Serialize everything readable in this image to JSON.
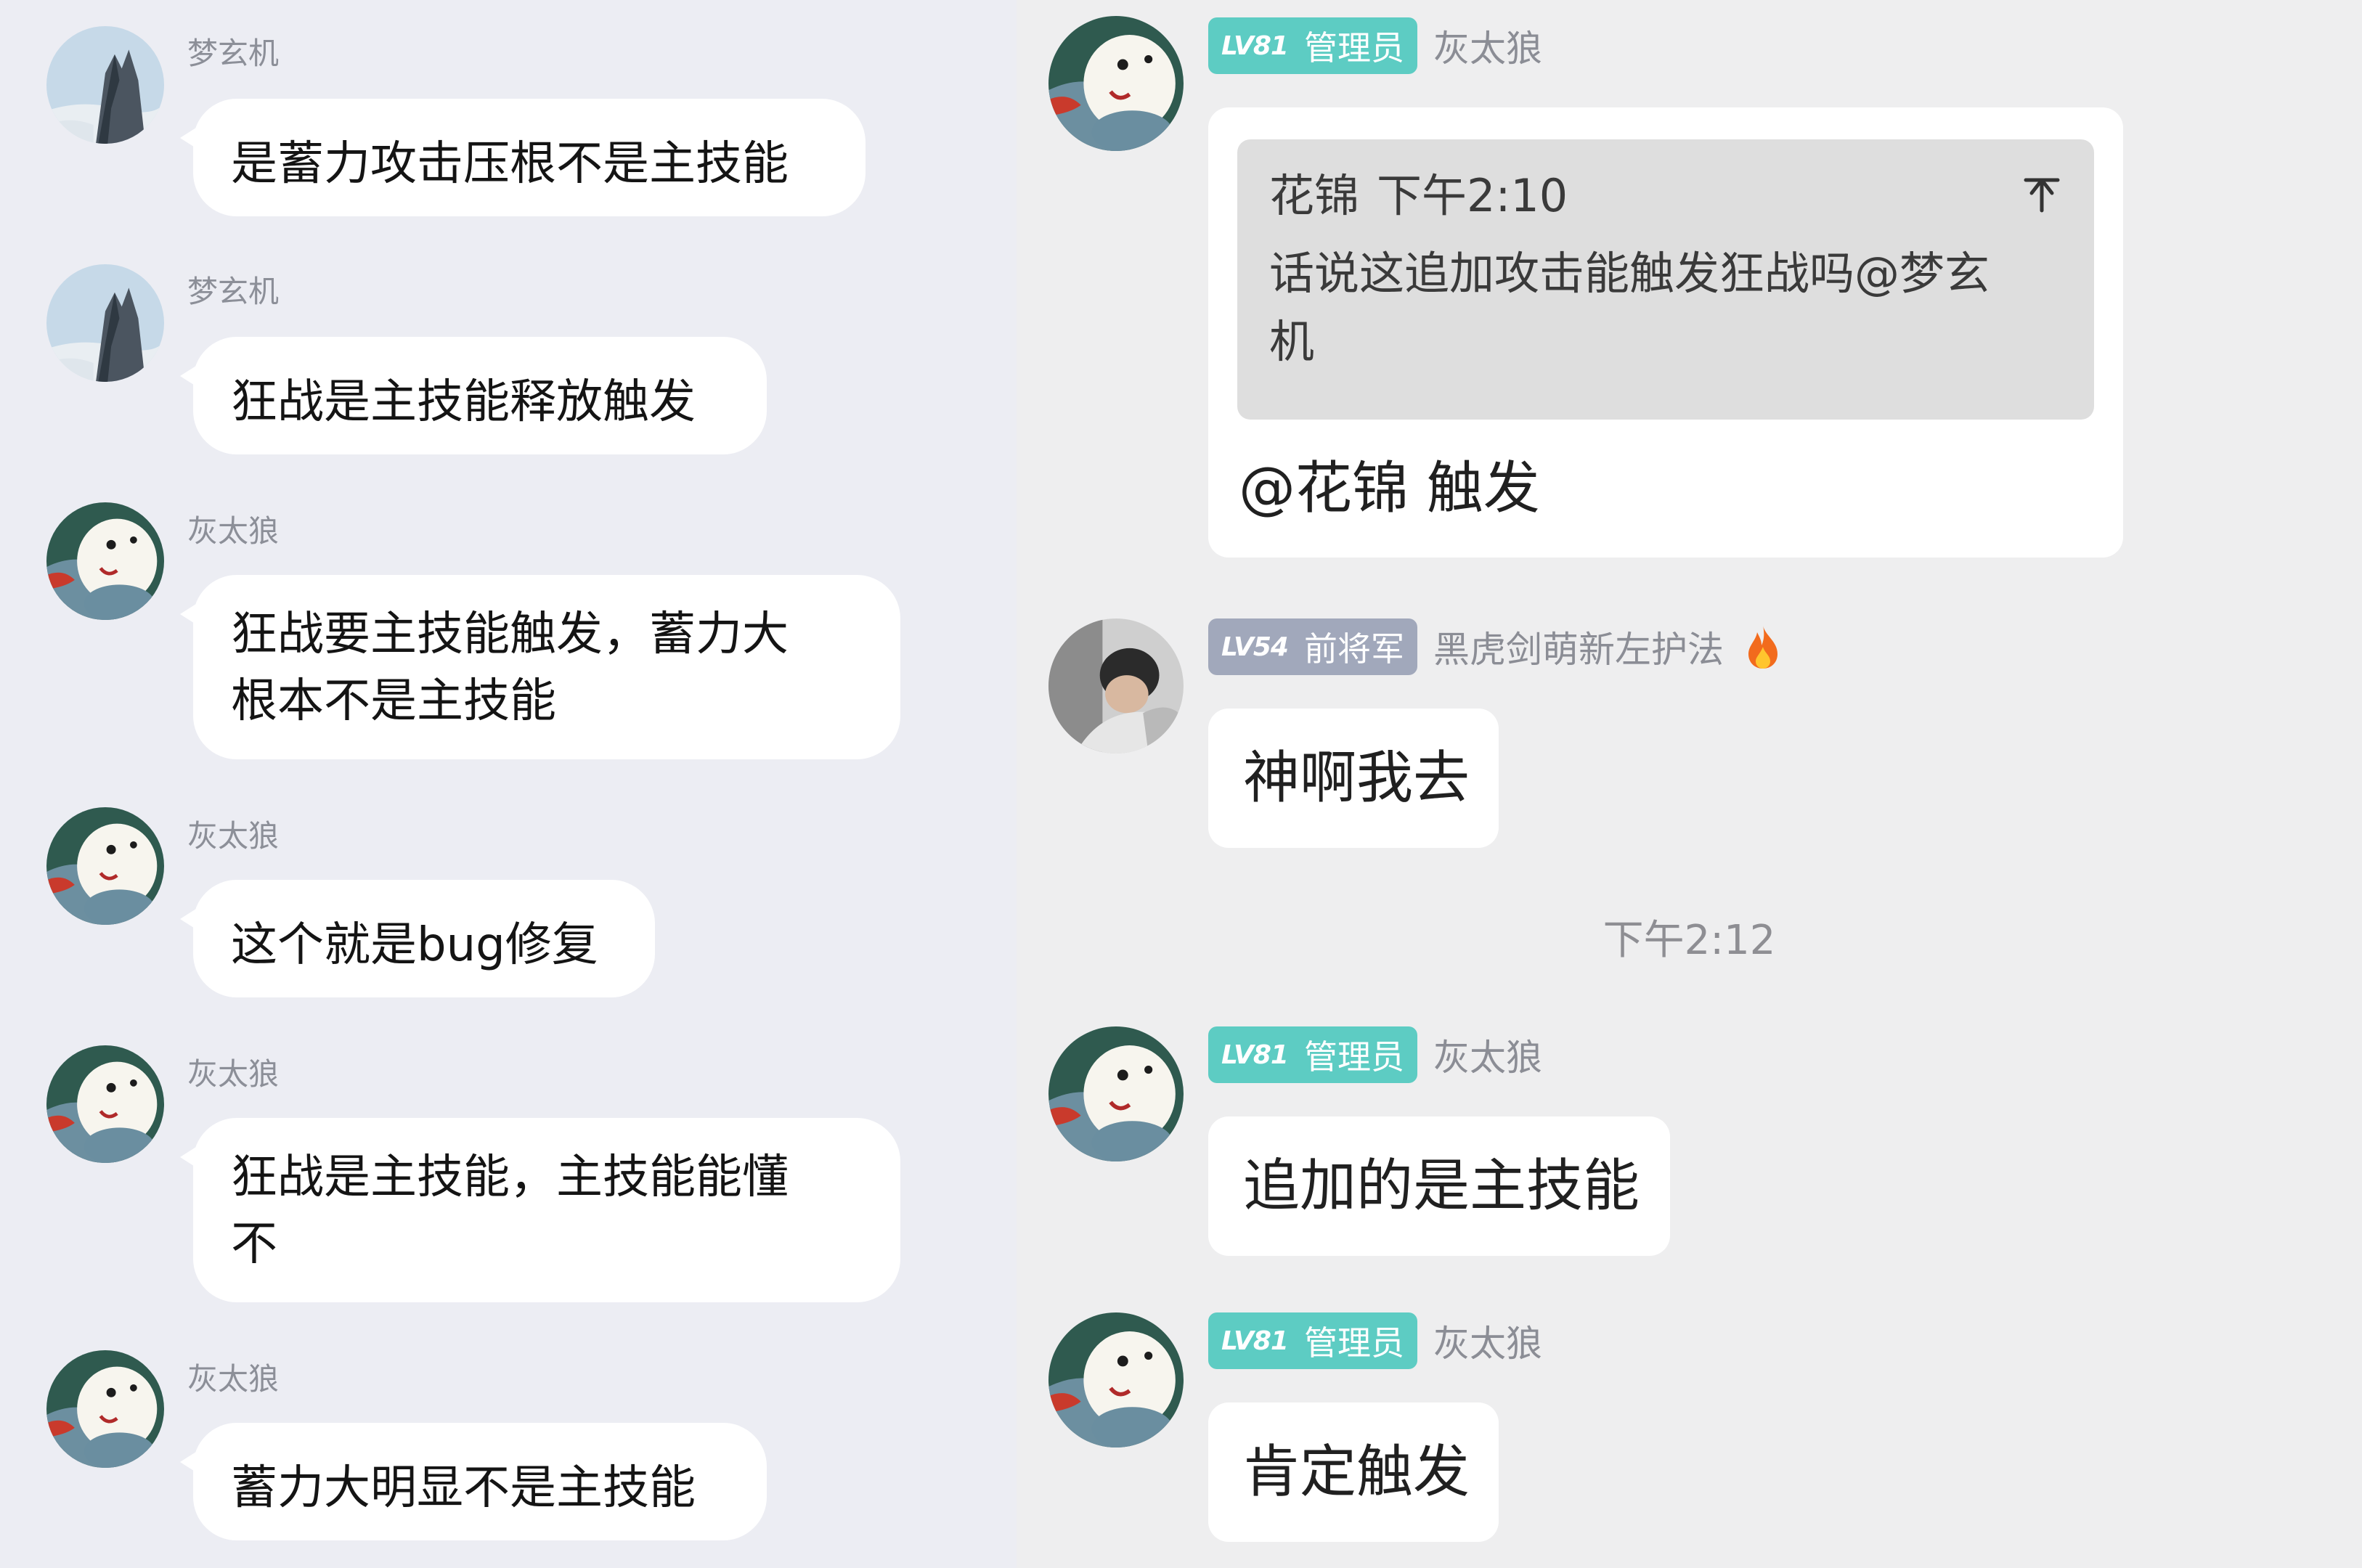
{
  "left_chat": {
    "messages": [
      {
        "sender": "梦玄机",
        "avatar": "mountain-avatar",
        "lines": [
          "是蓄力攻击压根不是主技能"
        ]
      },
      {
        "sender": "梦玄机",
        "avatar": "mountain-avatar",
        "lines": [
          "狂战是主技能释放触发"
        ]
      },
      {
        "sender": "灰太狼",
        "avatar": "cartoon-avatar",
        "lines": [
          "狂战要主技能触发，蓄力大",
          "根本不是主技能"
        ]
      },
      {
        "sender": "灰太狼",
        "avatar": "cartoon-avatar",
        "lines": [
          "这个就是bug修复"
        ]
      },
      {
        "sender": "灰太狼",
        "avatar": "cartoon-avatar",
        "lines": [
          "狂战是主技能，主技能能懂",
          "不"
        ]
      },
      {
        "sender": "灰太狼",
        "avatar": "cartoon-avatar",
        "lines": [
          "蓄力大明显不是主技能"
        ]
      }
    ]
  },
  "right_chat": {
    "messages": [
      {
        "level": "LV81",
        "role": "管理员",
        "sender": "灰太狼",
        "avatar": "cartoon-avatar",
        "quote": {
          "author": "花锦",
          "time": "下午2:10",
          "lines": [
            "话说这追加攻击能触发狂战吗@梦玄",
            "机"
          ],
          "icon": "pin-icon"
        },
        "text": "@花锦 触发"
      },
      {
        "level": "LV54",
        "role": "前将军",
        "sender": "黑虎剑萌新左护法",
        "avatar": "photo-avatar",
        "flair_icon": "fire-icon",
        "text": "神啊我去"
      },
      {
        "level": "LV81",
        "role": "管理员",
        "sender": "灰太狼",
        "avatar": "cartoon-avatar",
        "text": "追加的是主技能"
      },
      {
        "level": "LV81",
        "role": "管理员",
        "sender": "灰太狼",
        "avatar": "cartoon-avatar",
        "text": "肯定触发"
      }
    ],
    "timestamp": "下午2:12"
  },
  "colors": {
    "left_background": "#ecedf3",
    "right_background": "#eeeeef",
    "bubble": "#ffffff",
    "admin_badge": "#5dccc3",
    "general_badge": "#a1a8bb",
    "quote_box": "#dedede",
    "name_text": "#8c8f98"
  }
}
